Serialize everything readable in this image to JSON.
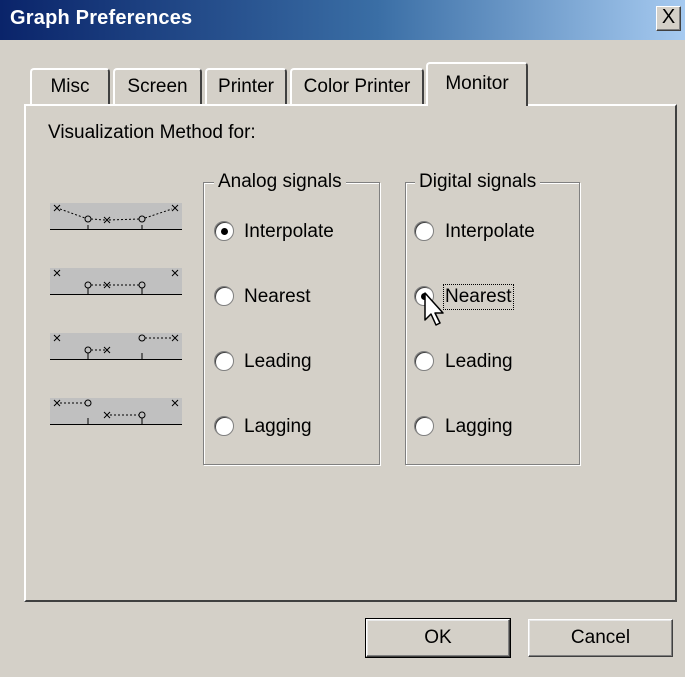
{
  "window": {
    "title": "Graph Preferences",
    "close_label": "X"
  },
  "tabs": [
    {
      "label": "Misc",
      "active": false
    },
    {
      "label": "Screen",
      "active": false
    },
    {
      "label": "Printer",
      "active": false
    },
    {
      "label": "Color Printer",
      "active": false
    },
    {
      "label": "Monitor",
      "active": true
    }
  ],
  "panel": {
    "visualization_label": "Visualization Method for:",
    "method_icons": [
      "interpolate-method-icon",
      "nearest-method-icon",
      "leading-method-icon",
      "lagging-method-icon"
    ],
    "analog_group": {
      "title": "Analog signals",
      "options": [
        "Interpolate",
        "Nearest",
        "Leading",
        "Lagging"
      ],
      "selected": "Interpolate"
    },
    "digital_group": {
      "title": "Digital signals",
      "options": [
        "Interpolate",
        "Nearest",
        "Leading",
        "Lagging"
      ],
      "selected": "Nearest",
      "focused": "Nearest"
    }
  },
  "buttons": {
    "ok": "OK",
    "cancel": "Cancel"
  },
  "colors": {
    "dialog_bg": "#d4d0c8",
    "title_gradient_start": "#0a246a",
    "title_gradient_end": "#a6caf0"
  },
  "cursor": "arrow-pointer-icon"
}
